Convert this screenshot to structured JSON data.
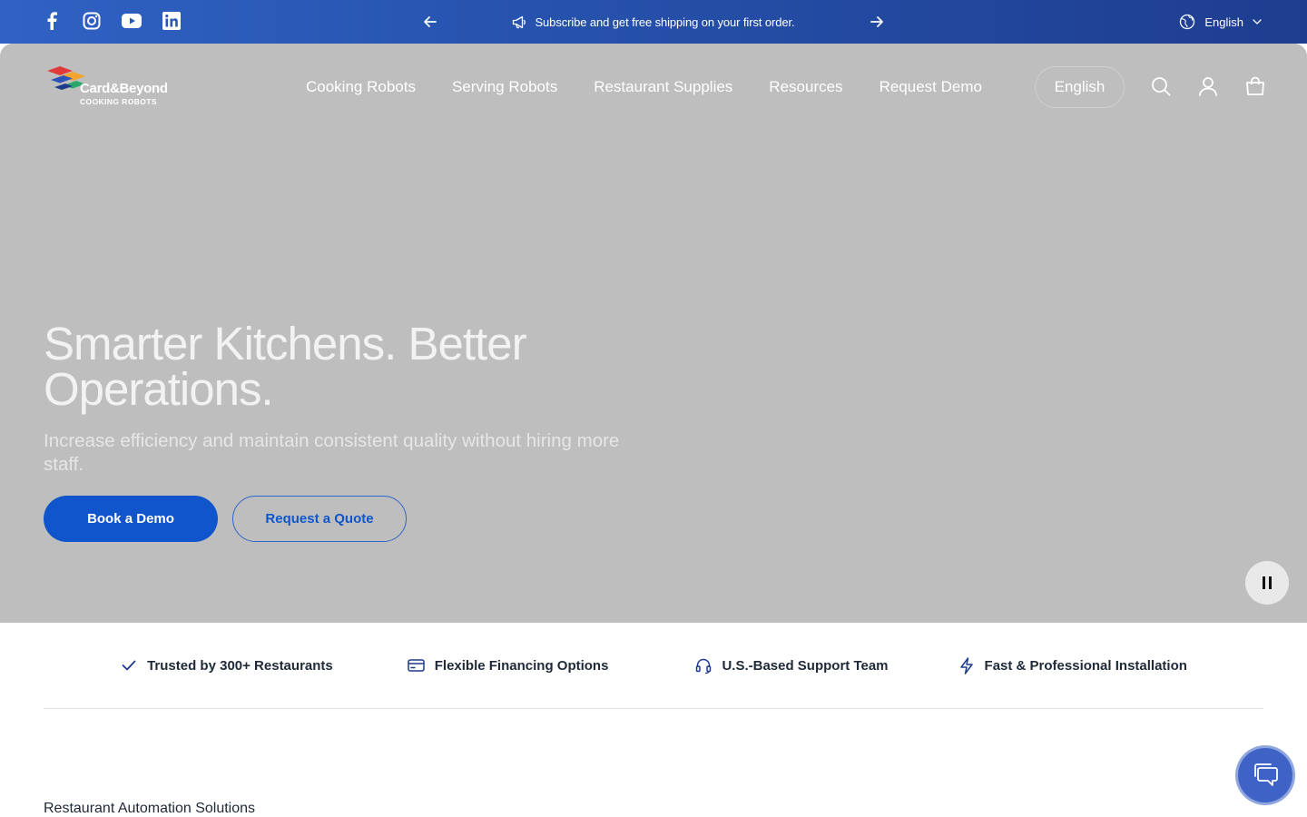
{
  "announcement": {
    "message": "Subscribe and get free shipping on your first order.",
    "language": "English"
  },
  "social": [
    "facebook-icon",
    "instagram-icon",
    "youtube-icon",
    "linkedin-icon"
  ],
  "logo": {
    "brand": "Card&Beyond",
    "tagline": "COOKING ROBOTS"
  },
  "nav": {
    "items": [
      "Cooking Robots",
      "Serving Robots",
      "Restaurant Supplies",
      "Resources",
      "Request Demo"
    ],
    "language": "English"
  },
  "hero": {
    "title": "Smarter Kitchens. Better Operations.",
    "subtitle": "Increase efficiency and maintain consistent quality without hiring more staff.",
    "primary_cta": "Book a Demo",
    "secondary_cta": "Request a Quote"
  },
  "features": [
    {
      "label": "Trusted by 300+ Restaurants",
      "icon": "check-icon"
    },
    {
      "label": "Flexible Financing Options",
      "icon": "credit-card-icon"
    },
    {
      "label": "U.S.-Based Support Team",
      "icon": "headset-icon"
    },
    {
      "label": "Fast & Professional Installation",
      "icon": "lightning-icon"
    }
  ],
  "section": {
    "label": "Restaurant Automation Solutions"
  },
  "colors": {
    "accent": "#1155cc",
    "topbar": "#254fa8",
    "hero_bg": "#bebebe"
  }
}
